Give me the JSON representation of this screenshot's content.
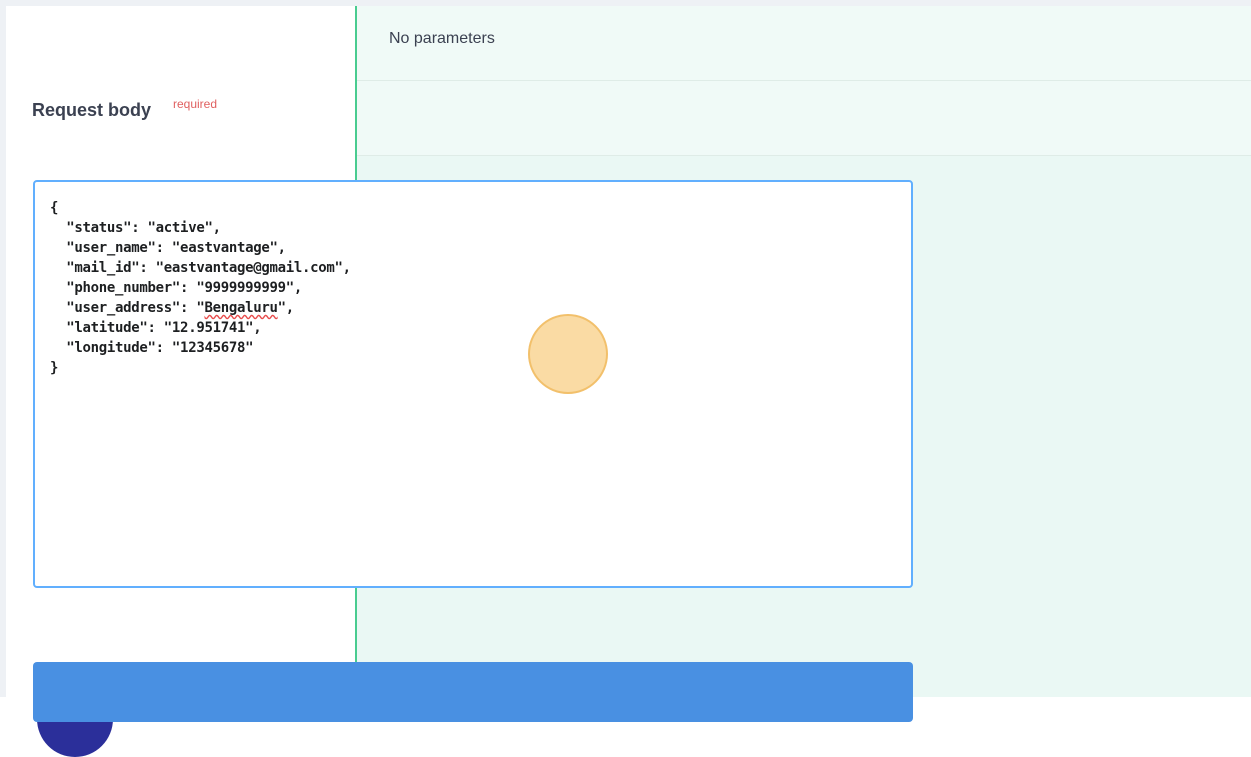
{
  "parameters": {
    "empty_text": "No parameters"
  },
  "request_body": {
    "title": "Request body",
    "required_flag": "required",
    "json_lines": [
      "{",
      "  \"status\": \"active\",",
      "  \"user_name\": \"eastvantage\",",
      "  \"mail_id\": \"eastvantage@gmail.com\",",
      "  \"phone_number\": \"9999999999\",",
      "  \"user_address\": \"Bengaluru\",",
      "  \"latitude\": \"12.951741\",",
      "  \"longitude\": \"12345678\"",
      "}"
    ]
  },
  "colors": {
    "accent_green": "#49cc90",
    "editor_border": "#61affe",
    "execute_blue": "#4990e2",
    "required_red": "#e06060"
  }
}
